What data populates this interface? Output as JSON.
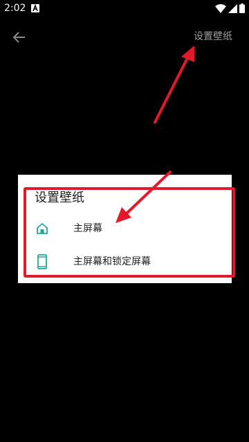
{
  "status_bar": {
    "time": "2:02",
    "notification_icon": "a-letter-icon",
    "icons": [
      "wifi-icon",
      "signal-icon",
      "battery-icon"
    ]
  },
  "app_bar": {
    "back_icon": "arrow-left-icon",
    "action_label": "设置壁纸"
  },
  "dialog": {
    "title": "设置壁纸",
    "options": [
      {
        "label": "主屏幕",
        "icon": "home-icon"
      },
      {
        "label": "主屏幕和锁定屏幕",
        "icon": "phone-icon"
      }
    ]
  },
  "colors": {
    "background": "#000000",
    "accent": "#26a69a",
    "annotation": "#e3192b",
    "action_text": "#9e9e9e"
  }
}
